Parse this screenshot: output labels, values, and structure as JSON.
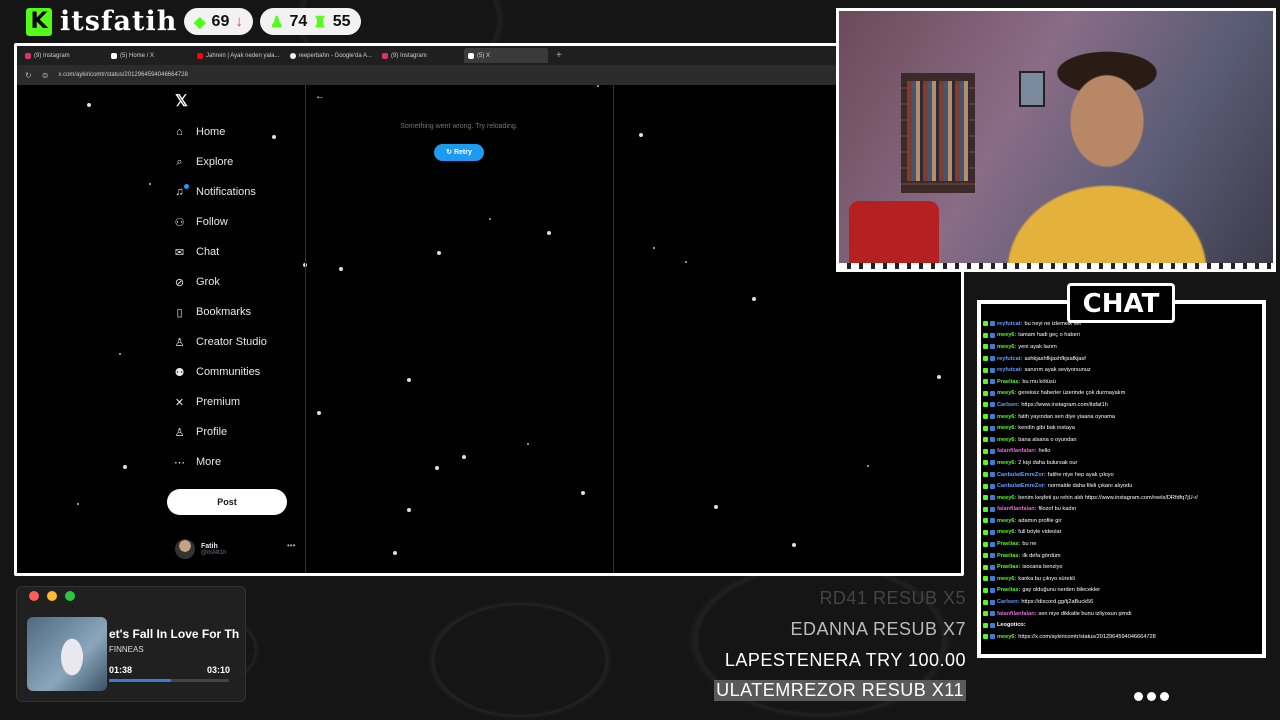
{
  "brand": {
    "name": "itsfatih"
  },
  "stats": {
    "viewers": "69",
    "followers": "74",
    "subs": "55"
  },
  "browser": {
    "tabs": [
      "(9) Instagram",
      "(5) Home / X",
      "Jahrein | Ayak neden yala...",
      "reeperbahn - Google'da A...",
      "(9) Instagram",
      "(5) X"
    ],
    "url": "x.com/aykiricomtr/status/2012964594046664728"
  },
  "x": {
    "nav": [
      {
        "label": "Home",
        "icon": "home-icon"
      },
      {
        "label": "Explore",
        "icon": "search-icon"
      },
      {
        "label": "Notifications",
        "icon": "bell-icon"
      },
      {
        "label": "Follow",
        "icon": "follow-icon"
      },
      {
        "label": "Chat",
        "icon": "mail-icon"
      },
      {
        "label": "Grok",
        "icon": "grok-icon"
      },
      {
        "label": "Bookmarks",
        "icon": "bookmark-icon"
      },
      {
        "label": "Creator Studio",
        "icon": "creator-icon"
      },
      {
        "label": "Communities",
        "icon": "communities-icon"
      },
      {
        "label": "Premium",
        "icon": "x-icon"
      },
      {
        "label": "Profile",
        "icon": "profile-icon"
      },
      {
        "label": "More",
        "icon": "more-icon"
      }
    ],
    "post_label": "Post",
    "user_name": "Fatih",
    "user_handle": "@itsf4t1h",
    "error": "Something went wrong. Try reloading.",
    "retry": "Retry"
  },
  "chat": {
    "title": "CHAT",
    "messages": [
      {
        "user": "reyfutcat",
        "color": "#5da0ff",
        "text": "bu neyi ne izlemelk ver"
      },
      {
        "user": "meey6",
        "color": "#53fc18",
        "text": "tamam hadi geç o haberi"
      },
      {
        "user": "meey6",
        "color": "#53fc18",
        "text": "yeni ayak lazım"
      },
      {
        "user": "reyfutcat",
        "color": "#5da0ff",
        "text": "ashkjashfkjashfkjsafkjasf"
      },
      {
        "user": "reyfutcat",
        "color": "#5da0ff",
        "text": "sanırım ayak seviyorsunuz"
      },
      {
        "user": "Praelias",
        "color": "#53fc18",
        "text": "bu mu kötüsü"
      },
      {
        "user": "meey6",
        "color": "#53fc18",
        "text": "gereksiz haberler üzerinde çok durmayalım"
      },
      {
        "user": "Carlsen",
        "color": "#5da0ff",
        "text": "https://www.instagram.com/itsfat1h"
      },
      {
        "user": "meey6",
        "color": "#53fc18",
        "text": "fatih yayından sen diye yiaana oynama"
      },
      {
        "user": "meey6",
        "color": "#53fc18",
        "text": "kendin gibi bak instaya"
      },
      {
        "user": "meey6",
        "color": "#53fc18",
        "text": "bana alsana o oyundan"
      },
      {
        "user": "falanfilanfalan",
        "color": "#e06bd6",
        "text": "hello"
      },
      {
        "user": "meey6",
        "color": "#53fc18",
        "text": "2 kişi daha bulursak our"
      },
      {
        "user": "CanbulatEmreZor",
        "color": "#5da0ff",
        "text": "fatihe niye hep ayak çıkıyo"
      },
      {
        "user": "CanbulatEmreZor",
        "color": "#5da0ff",
        "text": "normalde daha fileli çıkanı alıyodu"
      },
      {
        "user": "meey6",
        "color": "#53fc18",
        "text": "benim keşfeti şu rehin aldı https://www.instagram.com/reels/DRfdfq7jU-r/"
      },
      {
        "user": "falanfilanfalan",
        "color": "#e06bd6",
        "text": "filozof bu kadın"
      },
      {
        "user": "meey6",
        "color": "#53fc18",
        "text": "adamın profile gir"
      },
      {
        "user": "meey6",
        "color": "#53fc18",
        "text": "full böyle videolar"
      },
      {
        "user": "Praelias",
        "color": "#53fc18",
        "text": "bu ne"
      },
      {
        "user": "Praelias",
        "color": "#53fc18",
        "text": "ilk defa gördüm"
      },
      {
        "user": "Praelias",
        "color": "#53fc18",
        "text": "isocana benziyo"
      },
      {
        "user": "meey6",
        "color": "#53fc18",
        "text": "kanka bu çıkıyo sürekli"
      },
      {
        "user": "Praelias",
        "color": "#53fc18",
        "text": "gay olduğunu nerden bilecekler"
      },
      {
        "user": "Carlsen",
        "color": "#5da0ff",
        "text": "https://discord.gg/tj2aBuck56"
      },
      {
        "user": "falanfilanfalan",
        "color": "#e06bd6",
        "text": "sen niye dikkatle bunu izliyosun şimdi"
      },
      {
        "user": "Leogotico",
        "color": "#ffffff",
        "text": ""
      },
      {
        "user": "meey6",
        "color": "#53fc18",
        "text": "https://x.com/aykiricomtr/status/2012964594046664728"
      }
    ]
  },
  "player": {
    "song": "et's Fall In Love For Th",
    "artist": "FINNEAS",
    "elapsed": "01:38",
    "total": "03:10",
    "progress": 0.52
  },
  "events": [
    "RD41 RESUB X5",
    "EDANNA RESUB X7",
    "LAPESTENERA TRY 100.00",
    "ULATEMREZOR RESUB X11"
  ]
}
